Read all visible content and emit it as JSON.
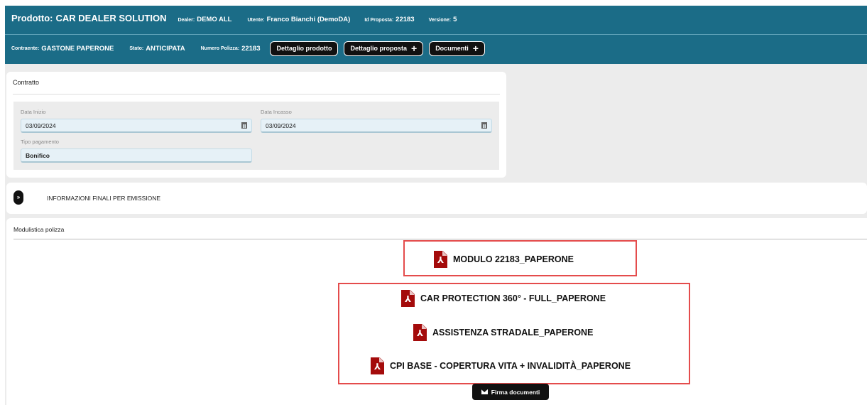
{
  "header": {
    "product_label": "Prodotto:",
    "product_value": "CAR DEALER SOLUTION",
    "dealer_label": "Dealer:",
    "dealer_value": "DEMO ALL",
    "user_label": "Utente:",
    "user_value": "Franco Bianchi (DemoDA)",
    "proposal_id_label": "Id Proposta:",
    "proposal_id_value": "22183",
    "version_label": "Versione:",
    "version_value": "5",
    "contractor_label": "Contraente:",
    "contractor_value": "GASTONE PAPERONE",
    "state_label": "Stato:",
    "state_value": "ANTICIPATA",
    "policy_number_label": "Numero Polizza:",
    "policy_number_value": "22183",
    "buttons": {
      "product_detail": "Dettaglio prodotto",
      "proposal_detail": "Dettaglio proposta",
      "documents": "Documenti"
    },
    "plus_glyph": "+"
  },
  "contratto": {
    "title": "Contratto",
    "start_date_label": "Data Inizio",
    "start_date_value": "03/09/2024",
    "collection_date_label": "Data Incasso",
    "collection_date_value": "03/09/2024",
    "payment_type_label": "Tipo pagamento",
    "payment_type_value": "Bonifico"
  },
  "info_finali": {
    "toggle_glyph": "»",
    "title": "INFORMAZIONI FINALI PER EMISSIONE"
  },
  "modulistica": {
    "title": "Modulistica polizza",
    "documents": [
      "MODULO 22183_PAPERONE",
      "CAR PROTECTION 360° - FULL_PAPERONE",
      "ASSISTENZA STRADALE_PAPERONE",
      "CPI BASE - COPERTURA VITA + INVALIDITÀ_PAPERONE"
    ],
    "pdf_glyph": "⅄",
    "sign_button": "Firma documenti"
  },
  "colors": {
    "header_bg": "#1b6c87",
    "highlight_border": "#e44c4c",
    "pdf_icon": "#a40b0b"
  }
}
